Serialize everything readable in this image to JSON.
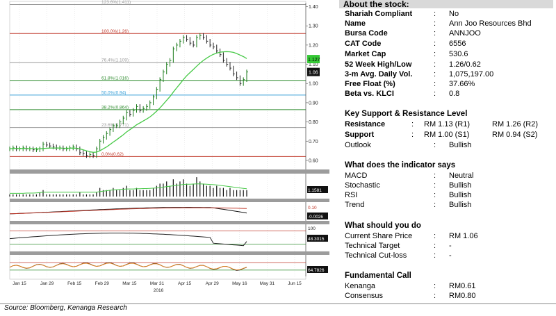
{
  "chart_data": {
    "type": "line",
    "price_axis": {
      "ticks": [
        "1.40",
        "1.30",
        "1.20",
        "1.10",
        "1.00",
        "0.90",
        "0.80",
        "0.70",
        "0.60"
      ],
      "min": 0.56,
      "max": 1.42
    },
    "x_ticks": [
      "Jan 15",
      "Jan 29",
      "Feb 15",
      "Feb 29",
      "Mar 15",
      "Mar 31",
      "Apr 15",
      "Apr 29",
      "May 16",
      "May 31",
      "Jun 15"
    ],
    "x_year": "2016",
    "fib_levels": [
      {
        "label": "123.6%(1.411)",
        "value": 1.411,
        "color": "#999999"
      },
      {
        "label": "100.0%(1.26)",
        "value": 1.26,
        "color": "#c0392b"
      },
      {
        "label": "76.4%(1.109)",
        "value": 1.109,
        "color": "#999999"
      },
      {
        "label": "61.8%(1.016)",
        "value": 1.016,
        "color": "#2e8b2e"
      },
      {
        "label": "50.0%(0.94)",
        "value": 0.94,
        "color": "#3aa0d8"
      },
      {
        "label": "38.2%(0.864)",
        "value": 0.864,
        "color": "#2e8b2e"
      },
      {
        "label": "23.6%(0.771)",
        "value": 0.771,
        "color": "#999999"
      },
      {
        "label": "0.0%(0.62)",
        "value": 0.62,
        "color": "#c0392b"
      }
    ],
    "price_series": [
      0.66,
      0.665,
      0.66,
      0.66,
      0.665,
      0.66,
      0.66,
      0.655,
      0.655,
      0.66,
      0.685,
      0.68,
      0.675,
      0.67,
      0.665,
      0.665,
      0.66,
      0.66,
      0.665,
      0.67,
      0.66,
      0.64,
      0.635,
      0.625,
      0.63,
      0.625,
      0.66,
      0.7,
      0.72,
      0.74,
      0.76,
      0.78,
      0.78,
      0.8,
      0.82,
      0.85,
      0.84,
      0.86,
      0.88,
      0.86,
      0.87,
      0.88,
      0.9,
      0.93,
      0.97,
      1.02,
      1.06,
      1.1,
      1.12,
      1.18,
      1.2,
      1.22,
      1.24,
      1.23,
      1.21,
      1.2,
      1.24,
      1.25,
      1.24,
      1.22,
      1.2,
      1.19,
      1.17,
      1.15,
      1.12,
      1.1,
      1.08,
      1.05,
      1.03,
      1.0,
      1.02,
      1.06
    ],
    "ma_series": [
      0.66,
      0.662,
      0.662,
      0.662,
      0.662,
      0.662,
      0.661,
      0.661,
      0.66,
      0.66,
      0.662,
      0.663,
      0.664,
      0.664,
      0.664,
      0.664,
      0.663,
      0.663,
      0.663,
      0.664,
      0.663,
      0.66,
      0.655,
      0.65,
      0.645,
      0.642,
      0.643,
      0.65,
      0.66,
      0.67,
      0.682,
      0.695,
      0.707,
      0.72,
      0.733,
      0.748,
      0.76,
      0.772,
      0.785,
      0.795,
      0.805,
      0.815,
      0.826,
      0.84,
      0.856,
      0.873,
      0.892,
      0.912,
      0.932,
      0.955,
      0.977,
      0.998,
      1.02,
      1.04,
      1.057,
      1.073,
      1.09,
      1.106,
      1.12,
      1.132,
      1.143,
      1.152,
      1.158,
      1.163,
      1.165,
      1.166,
      1.165,
      1.162,
      1.156,
      1.148,
      1.14,
      1.13
    ],
    "last_price_label": "1.06",
    "ma_label": "1.127",
    "volume_label": "1.1581",
    "volume": [
      1,
      1,
      1,
      1,
      1,
      1,
      1,
      1,
      1,
      2,
      3,
      1,
      1,
      1,
      1,
      1,
      1,
      1,
      1,
      1,
      1,
      2,
      1,
      1,
      1,
      1,
      2,
      4,
      3,
      3,
      3,
      4,
      3,
      3,
      4,
      5,
      3,
      3,
      4,
      3,
      3,
      3,
      3,
      4,
      5,
      6,
      6,
      7,
      5,
      8,
      6,
      7,
      8,
      6,
      5,
      6,
      9,
      7,
      6,
      5,
      5,
      4,
      5,
      4,
      4,
      3,
      4,
      3,
      3,
      3,
      3,
      3
    ],
    "volume_ma": [
      1.5,
      1.5,
      1.5,
      1.5,
      1.5,
      1.6,
      1.6,
      1.6,
      1.7,
      1.8,
      2,
      2,
      2,
      2,
      2,
      2,
      2,
      2,
      2,
      2,
      2,
      2,
      2,
      2,
      2,
      2,
      2,
      2.3,
      2.5,
      2.7,
      2.9,
      3.1,
      3.2,
      3.3,
      3.4,
      3.5,
      3.5,
      3.5,
      3.6,
      3.6,
      3.7,
      3.7,
      3.8,
      3.9,
      4,
      4.2,
      4.4,
      4.6,
      4.8,
      5,
      5.2,
      5.4,
      5.6,
      5.7,
      5.7,
      5.8,
      5.9,
      5.9,
      5.8,
      5.7,
      5.6,
      5.5,
      5.4,
      5.2,
      5,
      4.8,
      4.6,
      4.4,
      4.2,
      4,
      3.8,
      3.6
    ],
    "macd_labels": [
      "0.10",
      "-0.0026"
    ],
    "stoch_labels": [
      "100",
      "48.3015"
    ],
    "rsi_labels": [
      "64.7826"
    ]
  },
  "info": {
    "header": "About the stock:",
    "rows": [
      {
        "k": "Shariah Compliant",
        "v": "No"
      },
      {
        "k": "Name",
        "v": "Ann Joo Resources Bhd"
      },
      {
        "k": "Bursa Code",
        "v": "ANNJOO"
      },
      {
        "k": "CAT Code",
        "v": "6556"
      },
      {
        "k": "Market Cap",
        "v": "530.6"
      },
      {
        "k": "52 Week High/Low",
        "v": "1.26/0.62"
      },
      {
        "k": "3-m Avg. Daily Vol.",
        "v": "1,075,197.00"
      },
      {
        "k": "Free Float (%)",
        "v": "37.66%"
      },
      {
        "k": "Beta vs. KLCI",
        "v": "0.8"
      }
    ],
    "colon": ":",
    "kl_title": "Key Support & Resistance Level",
    "resistance_label": "Resistance",
    "resistance_r1": "RM 1.13 (R1)",
    "resistance_r2": "RM 1.26 (R2)",
    "support_label": "Support",
    "support_s1": "RM 1.00 (S1)",
    "support_s2": "RM 0.94 (S2)",
    "outlook_label": "Outlook",
    "outlook_value": "Bullish",
    "ind_title": "What does the indicator says",
    "indicators": [
      {
        "k": "MACD",
        "v": "Neutral"
      },
      {
        "k": "Stochastic",
        "v": "Bullish"
      },
      {
        "k": "RSI",
        "v": "Bullish"
      },
      {
        "k": "Trend",
        "v": "Bullish"
      }
    ],
    "do_title": "What should you do",
    "do_rows": [
      {
        "k": "Current Share Price",
        "v": "RM 1.06"
      },
      {
        "k": "Technical Target",
        "v": "-"
      },
      {
        "k": "Technical Cut-loss",
        "v": "-"
      }
    ],
    "fund_title": "Fundamental Call",
    "fund_rows": [
      {
        "k": "Kenanga",
        "v": "RM0.61"
      },
      {
        "k": "Consensus",
        "v": "RM0.80"
      }
    ]
  },
  "source": "Source: Bloomberg, Kenanga Research",
  "colors": {
    "price_up": "#2e8b2e",
    "ma": "#47c947",
    "grey_band": "#9c9c9c",
    "red": "#c0392b",
    "orange": "#e08020"
  }
}
